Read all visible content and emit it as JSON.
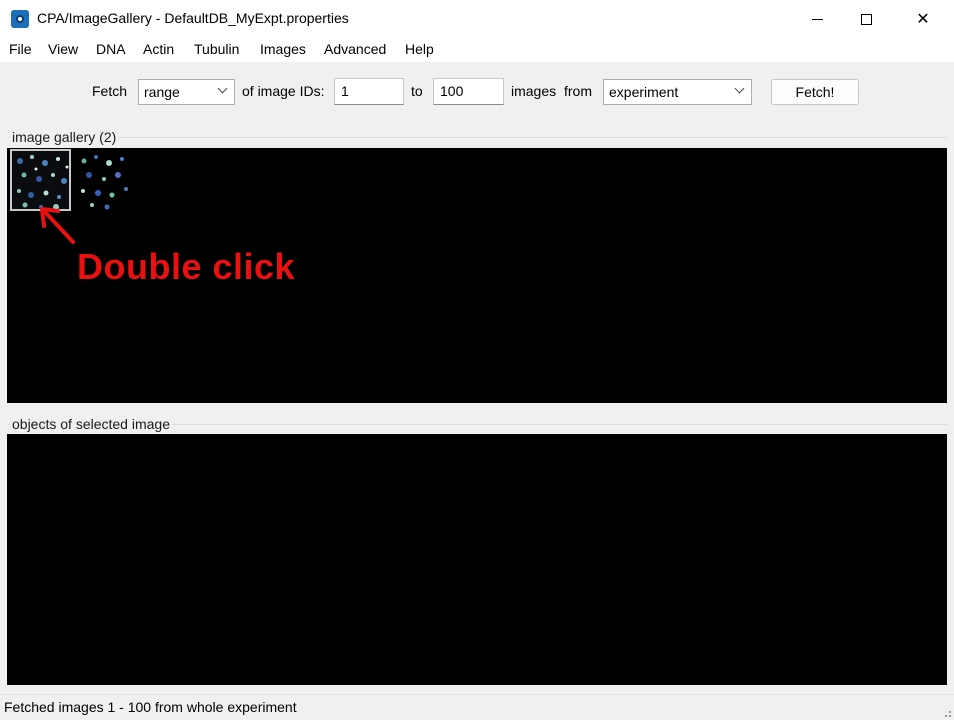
{
  "window": {
    "title": "CPA/ImageGallery - DefaultDB_MyExpt.properties",
    "app_icon": "cpa-app-icon",
    "controls": [
      "minimize-icon",
      "maximize-icon",
      "close-icon"
    ],
    "close_glyph": "✕"
  },
  "menu": {
    "items": [
      "File",
      "View",
      "DNA",
      "Actin",
      "Tubulin",
      "Images",
      "Advanced",
      "Help"
    ]
  },
  "toolbar": {
    "fetch_label": "Fetch",
    "mode_value": "range",
    "of_image_ids_label": "of image IDs:",
    "from_id": "1",
    "to_label": "to",
    "to_id": "100",
    "images_label": "images",
    "from_label": "from",
    "source_value": "experiment",
    "fetch_button": "Fetch!"
  },
  "gallery": {
    "label": "image gallery (2)",
    "thumbnails": [
      "thumbnail-1",
      "thumbnail-2"
    ],
    "selected_index": 0
  },
  "objects": {
    "label": "objects of selected image"
  },
  "annotation": {
    "text": "Double click",
    "color": "#e81010"
  },
  "status": {
    "text": "Fetched images 1 - 100  from whole experiment"
  }
}
